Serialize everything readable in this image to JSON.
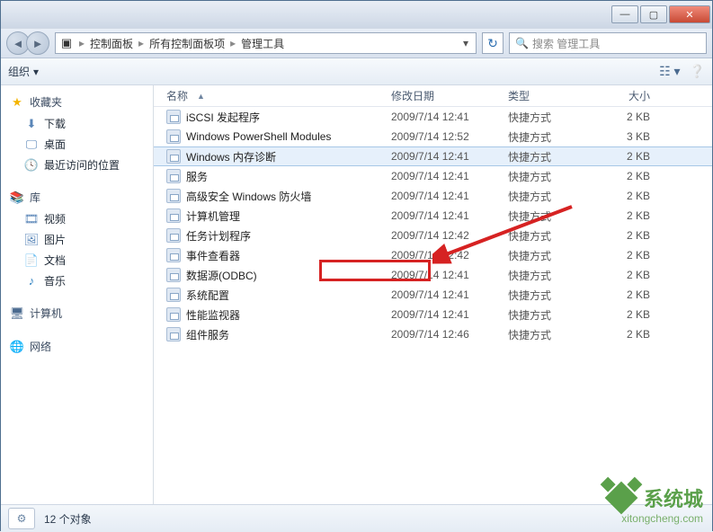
{
  "breadcrumb": {
    "icon": "control-panel-icon",
    "items": [
      "控制面板",
      "所有控制面板项",
      "管理工具"
    ]
  },
  "search": {
    "placeholder": "搜索 管理工具"
  },
  "toolbar": {
    "organize": "组织"
  },
  "sidebar": {
    "groups": [
      {
        "title": "收藏夹",
        "icon": "star",
        "items": [
          {
            "label": "下载",
            "icon": "download"
          },
          {
            "label": "桌面",
            "icon": "desktop"
          },
          {
            "label": "最近访问的位置",
            "icon": "recent"
          }
        ]
      },
      {
        "title": "库",
        "icon": "library",
        "items": [
          {
            "label": "视频",
            "icon": "video"
          },
          {
            "label": "图片",
            "icon": "picture"
          },
          {
            "label": "文档",
            "icon": "document"
          },
          {
            "label": "音乐",
            "icon": "music"
          }
        ]
      },
      {
        "title": "计算机",
        "icon": "computer",
        "items": []
      },
      {
        "title": "网络",
        "icon": "network",
        "items": []
      }
    ]
  },
  "columns": {
    "name": "名称",
    "date": "修改日期",
    "type": "类型",
    "size": "大小"
  },
  "rows": [
    {
      "name": "iSCSI 发起程序",
      "date": "2009/7/14 12:41",
      "type": "快捷方式",
      "size": "2 KB"
    },
    {
      "name": "Windows PowerShell Modules",
      "date": "2009/7/14 12:52",
      "type": "快捷方式",
      "size": "3 KB"
    },
    {
      "name": "Windows 内存诊断",
      "date": "2009/7/14 12:41",
      "type": "快捷方式",
      "size": "2 KB",
      "selected": true
    },
    {
      "name": "服务",
      "date": "2009/7/14 12:41",
      "type": "快捷方式",
      "size": "2 KB",
      "highlighted": true
    },
    {
      "name": "高级安全 Windows 防火墙",
      "date": "2009/7/14 12:41",
      "type": "快捷方式",
      "size": "2 KB"
    },
    {
      "name": "计算机管理",
      "date": "2009/7/14 12:41",
      "type": "快捷方式",
      "size": "2 KB"
    },
    {
      "name": "任务计划程序",
      "date": "2009/7/14 12:42",
      "type": "快捷方式",
      "size": "2 KB"
    },
    {
      "name": "事件查看器",
      "date": "2009/7/14 12:42",
      "type": "快捷方式",
      "size": "2 KB"
    },
    {
      "name": "数据源(ODBC)",
      "date": "2009/7/14 12:41",
      "type": "快捷方式",
      "size": "2 KB"
    },
    {
      "name": "系统配置",
      "date": "2009/7/14 12:41",
      "type": "快捷方式",
      "size": "2 KB"
    },
    {
      "name": "性能监视器",
      "date": "2009/7/14 12:41",
      "type": "快捷方式",
      "size": "2 KB"
    },
    {
      "name": "组件服务",
      "date": "2009/7/14 12:46",
      "type": "快捷方式",
      "size": "2 KB"
    }
  ],
  "status": {
    "count_label": "12 个对象"
  },
  "watermark": {
    "brand": "系统城",
    "url": "xitongcheng.com"
  }
}
